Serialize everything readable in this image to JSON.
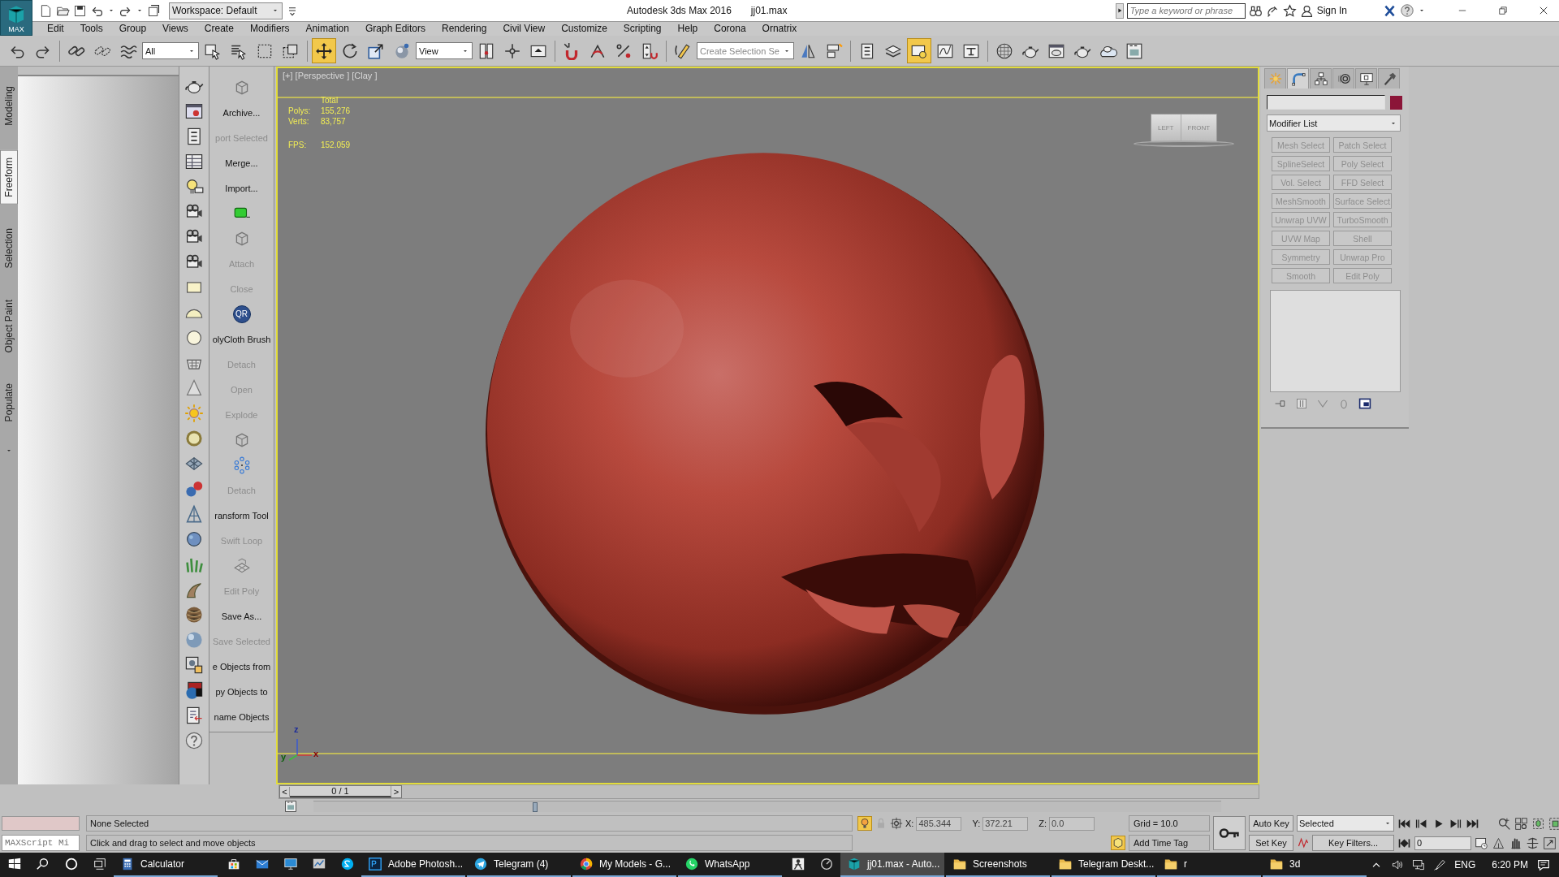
{
  "title_bar": {
    "app_badge": "MAX",
    "workspace": "Workspace: Default",
    "app_title": "Autodesk 3ds Max 2016",
    "file_name": "jj01.max",
    "search": {
      "placeholder": "Type a keyword or phrase"
    },
    "sign_in": "Sign In"
  },
  "menu": [
    "Edit",
    "Tools",
    "Group",
    "Views",
    "Create",
    "Modifiers",
    "Animation",
    "Graph Editors",
    "Rendering",
    "Civil View",
    "Customize",
    "Scripting",
    "Help",
    "Corona",
    "Ornatrix"
  ],
  "toolbar": [
    {
      "kind": "undo",
      "selected": false
    },
    {
      "kind": "redo",
      "selected": false
    },
    {
      "kind": "separator"
    },
    {
      "kind": "link",
      "selected": false
    },
    {
      "kind": "unlink",
      "selected": false
    },
    {
      "kind": "bind",
      "selected": false
    },
    {
      "kind": "dropdown",
      "value": "All"
    },
    {
      "kind": "select",
      "selected": false
    },
    {
      "kind": "select-by-name",
      "selected": false
    },
    {
      "kind": "region",
      "selected": false
    },
    {
      "kind": "crossing",
      "selected": false
    },
    {
      "kind": "separator"
    },
    {
      "kind": "move",
      "selected": true
    },
    {
      "kind": "rotate",
      "selected": false
    },
    {
      "kind": "scale",
      "selected": false
    },
    {
      "kind": "pivot",
      "selected": false
    },
    {
      "kind": "dropdown",
      "value": "View"
    },
    {
      "kind": "mirror-pivot",
      "selected": false
    },
    {
      "kind": "manipulate",
      "selected": false
    },
    {
      "kind": "place",
      "selected": false
    },
    {
      "kind": "separator"
    },
    {
      "kind": "snap",
      "selected": false
    },
    {
      "kind": "angle-snap",
      "selected": false
    },
    {
      "kind": "percent-snap",
      "selected": false
    },
    {
      "kind": "spinner-snap",
      "selected": false
    },
    {
      "kind": "separator"
    },
    {
      "kind": "edit-named",
      "selected": false
    },
    {
      "kind": "dropdown",
      "placeholder": "Create Selection Se"
    },
    {
      "kind": "mirror",
      "selected": false
    },
    {
      "kind": "align",
      "selected": false
    },
    {
      "kind": "separator"
    },
    {
      "kind": "list",
      "selected": false
    },
    {
      "kind": "layers",
      "selected": false
    },
    {
      "kind": "explorer",
      "selected": true
    },
    {
      "kind": "curve",
      "selected": false
    },
    {
      "kind": "schematic",
      "selected": false
    },
    {
      "kind": "separator"
    },
    {
      "kind": "material",
      "selected": false
    },
    {
      "kind": "render-setup",
      "selected": false
    },
    {
      "kind": "render-window",
      "selected": false
    },
    {
      "kind": "render",
      "selected": false
    },
    {
      "kind": "render-cloud",
      "selected": false
    },
    {
      "kind": "frame",
      "selected": false
    }
  ],
  "ribbon_tabs": [
    {
      "label": "Modeling",
      "selected": false
    },
    {
      "label": "Freeform",
      "selected": true
    },
    {
      "label": "Selection",
      "selected": false
    },
    {
      "label": "Object Paint",
      "selected": false
    },
    {
      "label": "Populate",
      "selected": false
    }
  ],
  "tool_panel": [
    {
      "kind": "wire-cube"
    },
    {
      "kind": "button",
      "label": "Archive...",
      "disabled": false
    },
    {
      "kind": "button",
      "label": "port Selected",
      "disabled": true
    },
    {
      "kind": "button",
      "label": "Merge...",
      "disabled": false
    },
    {
      "kind": "button",
      "label": "Import...",
      "disabled": false
    },
    {
      "kind": "green-box"
    },
    {
      "kind": "wire-cube"
    },
    {
      "kind": "button",
      "label": "Attach",
      "disabled": true
    },
    {
      "kind": "button",
      "label": "Close",
      "disabled": true
    },
    {
      "kind": "badge",
      "label": "QR"
    },
    {
      "kind": "button",
      "label": "olyCloth Brush",
      "disabled": false
    },
    {
      "kind": "button",
      "label": "Detach",
      "disabled": true
    },
    {
      "kind": "button",
      "label": "Open",
      "disabled": true
    },
    {
      "kind": "button",
      "label": "Explode",
      "disabled": true
    },
    {
      "kind": "wire-cube"
    },
    {
      "kind": "dots"
    },
    {
      "kind": "button",
      "label": "Detach",
      "disabled": true
    },
    {
      "kind": "button",
      "label": "ransform Tool",
      "disabled": false
    },
    {
      "kind": "button",
      "label": "Swift Loop",
      "disabled": true
    },
    {
      "kind": "plane"
    },
    {
      "kind": "button",
      "label": "Edit Poly",
      "disabled": true
    },
    {
      "kind": "button",
      "label": "Save As...",
      "disabled": false
    },
    {
      "kind": "button",
      "label": "Save Selected",
      "disabled": true
    },
    {
      "kind": "button",
      "label": "e Objects from",
      "disabled": false
    },
    {
      "kind": "button",
      "label": "py Objects to",
      "disabled": false
    },
    {
      "kind": "button",
      "label": "name Objects",
      "disabled": false
    }
  ],
  "viewport": {
    "label": "[+] [Perspective ] [Clay ]",
    "stats": {
      "header": "Total",
      "rows": [
        {
          "label": "Polys:",
          "value": "155,276"
        },
        {
          "label": "Verts:",
          "value": "83,757"
        },
        {
          "label": "FPS:",
          "value": "152.059"
        }
      ]
    },
    "view_cube": [
      "LEFT",
      "FRONT"
    ],
    "axis_labels": [
      "z",
      "y",
      "x"
    ]
  },
  "command_panel": {
    "tabs": [
      {
        "kind": "create",
        "selected": false
      },
      {
        "kind": "modify",
        "selected": true
      },
      {
        "kind": "hierarchy",
        "selected": false
      },
      {
        "kind": "motion",
        "selected": false
      },
      {
        "kind": "display",
        "selected": false
      },
      {
        "kind": "utilities",
        "selected": false
      }
    ],
    "object_swatch": {
      "color": "#8b1538"
    },
    "modifier_list": "Modifier List",
    "modifier_buttons": [
      {
        "label": "Mesh Select",
        "disabled": true
      },
      {
        "label": "Patch Select",
        "disabled": true
      },
      {
        "label": "SplineSelect",
        "disabled": true
      },
      {
        "label": "Poly Select",
        "disabled": true
      },
      {
        "label": "Vol. Select",
        "disabled": true
      },
      {
        "label": "FFD Select",
        "disabled": true
      },
      {
        "label": "MeshSmooth",
        "disabled": true
      },
      {
        "label": "Surface Select",
        "disabled": true
      },
      {
        "label": "Unwrap UVW",
        "disabled": true
      },
      {
        "label": "TurboSmooth",
        "disabled": true
      },
      {
        "label": "UVW Map",
        "disabled": true
      },
      {
        "label": "Shell",
        "disabled": true
      },
      {
        "label": "Symmetry",
        "disabled": true
      },
      {
        "label": "Unwrap Pro",
        "disabled": true
      },
      {
        "label": "Smooth",
        "disabled": true
      },
      {
        "label": "Edit Poly",
        "disabled": true
      }
    ]
  },
  "time_slider": {
    "prev": "<",
    "frame": "0 / 1",
    "next": ">",
    "level": 0
  },
  "status": {
    "maxscript": {
      "placeholder": "MAXScript Mi"
    },
    "selection": "None Selected",
    "prompt": "Click and drag to select and move objects",
    "coords": [
      {
        "label": "X:",
        "value": "485.344"
      },
      {
        "label": "Y:",
        "value": "372.21"
      },
      {
        "label": "Z:",
        "value": "0.0"
      }
    ],
    "grid": "Grid = 10.0",
    "time_tag": "Add Time Tag",
    "auto_key": "Auto Key",
    "set_key": "Set Key",
    "key_mode": "Selected",
    "key_filters": "Key Filters...",
    "current_frame": "0"
  },
  "taskbar": {
    "apps": [
      {
        "kind": "calculator",
        "label": "Calculator",
        "running": true,
        "selected": false
      },
      {
        "kind": "store",
        "running": false,
        "selected": false
      },
      {
        "kind": "mail",
        "running": false,
        "selected": false
      },
      {
        "kind": "monitor",
        "running": false,
        "selected": false
      },
      {
        "kind": "chart",
        "running": false,
        "selected": false
      },
      {
        "kind": "skype",
        "running": false,
        "selected": false
      },
      {
        "kind": "photoshop",
        "label": "Adobe Photosh...",
        "running": true,
        "selected": false
      },
      {
        "kind": "telegram",
        "label": "Telegram (4)",
        "running": true,
        "selected": false
      },
      {
        "kind": "chrome",
        "label": "My Models - G...",
        "running": true,
        "selected": false
      },
      {
        "kind": "whatsapp",
        "label": "WhatsApp",
        "running": true,
        "selected": false
      },
      {
        "kind": "figure",
        "running": false,
        "selected": false
      },
      {
        "kind": "gauge",
        "running": false,
        "selected": false
      },
      {
        "kind": "max",
        "label": "jj01.max - Auto...",
        "running": true,
        "selected": true
      },
      {
        "kind": "folder",
        "label": "Screenshots",
        "running": true,
        "selected": false
      },
      {
        "kind": "folder",
        "label": "Telegram Deskt...",
        "running": true,
        "selected": false
      },
      {
        "kind": "folder",
        "label": "r",
        "running": true,
        "selected": false
      },
      {
        "kind": "folder",
        "label": "3d",
        "running": true,
        "selected": false
      }
    ],
    "language": "ENG",
    "clock": "6:20 PM"
  }
}
